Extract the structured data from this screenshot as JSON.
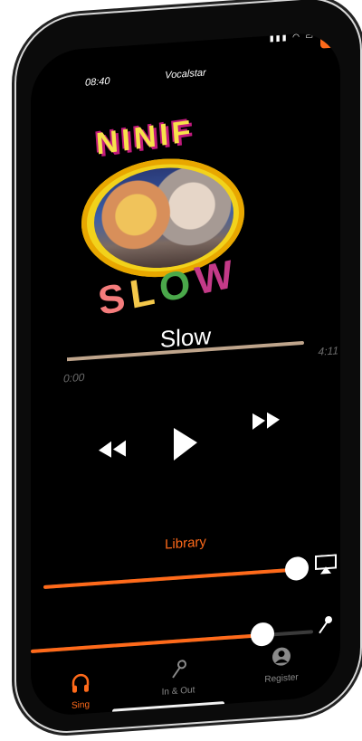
{
  "status": {
    "time": "08:40",
    "app_title": "Vocalstar",
    "icons": [
      "cellular-signal-icon",
      "wifi-icon",
      "battery-icon"
    ]
  },
  "now_playing": {
    "album_art": {
      "band_text": "NINIF",
      "song_text": [
        "S",
        "L",
        "O",
        "W"
      ]
    },
    "song_title": "Slow",
    "elapsed": "0:00",
    "total": "4:11",
    "progress": 0.0
  },
  "controls": {
    "rewind": "rewind-icon",
    "play": "play-icon",
    "fast_forward": "fast-forward-icon"
  },
  "library": {
    "label": "Library"
  },
  "sliders": {
    "music_volume": 1.0,
    "mic_volume": 0.82
  },
  "tabs": [
    {
      "id": "sing",
      "label": "Sing",
      "icon": "headphones-icon",
      "active": true
    },
    {
      "id": "inout",
      "label": "In & Out",
      "icon": "microphone-icon",
      "active": false
    },
    {
      "id": "register",
      "label": "Register",
      "icon": "person-circle-icon",
      "active": false
    }
  ],
  "colors": {
    "accent": "#ff6a1a",
    "scrubber": "#bfa58c",
    "inactive": "#8a8a8a",
    "background": "#000000"
  }
}
